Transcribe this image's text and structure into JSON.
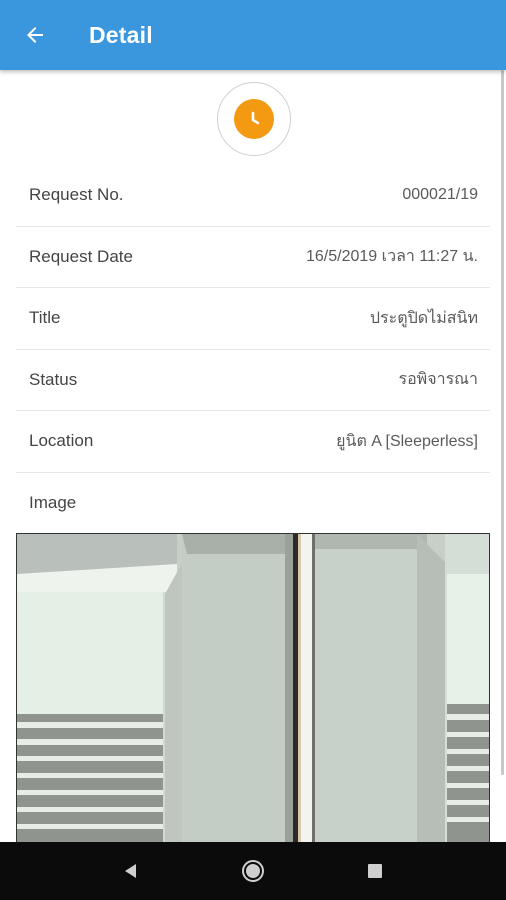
{
  "app_bar": {
    "title": "Detail",
    "back_icon": "arrow-left-icon",
    "color": "#3a97dd"
  },
  "status_indicator": {
    "icon": "clock-icon",
    "color": "#f39a12"
  },
  "details": [
    {
      "label": "Request No.",
      "value": "000021/19"
    },
    {
      "label": "Request Date",
      "value": "16/5/2019 เวลา 11:27 น."
    },
    {
      "label": "Title",
      "value": "ประตูปิดไม่สนิท"
    },
    {
      "label": "Status",
      "value": "รอพิจารณา"
    },
    {
      "label": "Location",
      "value": "ยูนิต A [Sleeperless]"
    },
    {
      "label": "Image",
      "value": ""
    }
  ],
  "nav_bar": {
    "back_icon": "triangle-back-icon",
    "home_icon": "circle-home-icon",
    "recents_icon": "square-recents-icon"
  }
}
